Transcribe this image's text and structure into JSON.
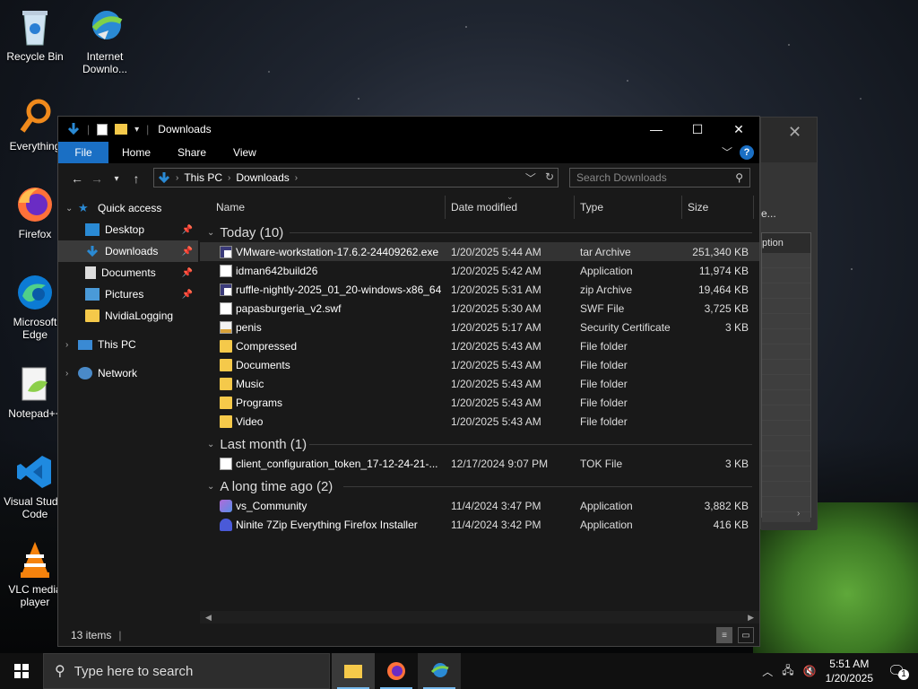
{
  "desktop": {
    "icons": [
      {
        "label": "Recycle Bin",
        "icon": "recycle-bin-icon"
      },
      {
        "label": "Internet Downlo...",
        "icon": "idm-icon"
      },
      {
        "label": "Everything",
        "icon": "everything-search-icon"
      },
      {
        "label": "Firefox",
        "icon": "firefox-icon"
      },
      {
        "label": "Microsoft Edge",
        "icon": "edge-icon"
      },
      {
        "label": "Notepad++",
        "icon": "notepadpp-icon"
      },
      {
        "label": "Visual Studio Code",
        "icon": "vscode-icon"
      },
      {
        "label": "VLC media player",
        "icon": "vlc-icon"
      }
    ]
  },
  "bgdialog": {
    "option_label": "ption",
    "ellipsis": "e..."
  },
  "explorer": {
    "title": "Downloads",
    "ribbon_tabs": [
      "File",
      "Home",
      "Share",
      "View"
    ],
    "help": "?",
    "breadcrumb": [
      "This PC",
      "Downloads"
    ],
    "search_placeholder": "Search Downloads",
    "nav": {
      "quick_access": "Quick access",
      "items": [
        "Desktop",
        "Downloads",
        "Documents",
        "Pictures",
        "NvidiaLogging"
      ],
      "this_pc": "This PC",
      "network": "Network"
    },
    "columns": [
      "Name",
      "Date modified",
      "Type",
      "Size"
    ],
    "groups": [
      {
        "title": "Today (10)",
        "rows": [
          {
            "name": "VMware-workstation-17.6.2-24409262.exe",
            "date": "1/20/2025 5:44 AM",
            "type": "tar Archive",
            "size": "251,340 KB",
            "icon": "archive-icon"
          },
          {
            "name": "idman642build26",
            "date": "1/20/2025 5:42 AM",
            "type": "Application",
            "size": "11,974 KB",
            "icon": "file-icon"
          },
          {
            "name": "ruffle-nightly-2025_01_20-windows-x86_64",
            "date": "1/20/2025 5:31 AM",
            "type": "zip Archive",
            "size": "19,464 KB",
            "icon": "archive-icon"
          },
          {
            "name": "papasburgeria_v2.swf",
            "date": "1/20/2025 5:30 AM",
            "type": "SWF File",
            "size": "3,725 KB",
            "icon": "file-icon"
          },
          {
            "name": "penis",
            "date": "1/20/2025 5:17 AM",
            "type": "Security Certificate",
            "size": "3 KB",
            "icon": "certificate-icon"
          },
          {
            "name": "Compressed",
            "date": "1/20/2025 5:43 AM",
            "type": "File folder",
            "size": "",
            "icon": "folder-icon"
          },
          {
            "name": "Documents",
            "date": "1/20/2025 5:43 AM",
            "type": "File folder",
            "size": "",
            "icon": "folder-icon"
          },
          {
            "name": "Music",
            "date": "1/20/2025 5:43 AM",
            "type": "File folder",
            "size": "",
            "icon": "folder-icon"
          },
          {
            "name": "Programs",
            "date": "1/20/2025 5:43 AM",
            "type": "File folder",
            "size": "",
            "icon": "folder-icon"
          },
          {
            "name": "Video",
            "date": "1/20/2025 5:43 AM",
            "type": "File folder",
            "size": "",
            "icon": "folder-icon"
          }
        ]
      },
      {
        "title": "Last month (1)",
        "rows": [
          {
            "name": "client_configuration_token_17-12-24-21-...",
            "date": "12/17/2024 9:07 PM",
            "type": "TOK File",
            "size": "3 KB",
            "icon": "file-icon"
          }
        ]
      },
      {
        "title": "A long time ago (2)",
        "rows": [
          {
            "name": "vs_Community",
            "date": "11/4/2024 3:47 PM",
            "type": "Application",
            "size": "3,882 KB",
            "icon": "vs-installer-icon"
          },
          {
            "name": "Ninite 7Zip Everything Firefox Installer",
            "date": "11/4/2024 3:42 PM",
            "type": "Application",
            "size": "416 KB",
            "icon": "ninite-icon"
          }
        ]
      }
    ],
    "status": "13 items"
  },
  "taskbar": {
    "search_placeholder": "Type here to search",
    "time": "5:51 AM",
    "date": "1/20/2025",
    "notifications": "1"
  }
}
